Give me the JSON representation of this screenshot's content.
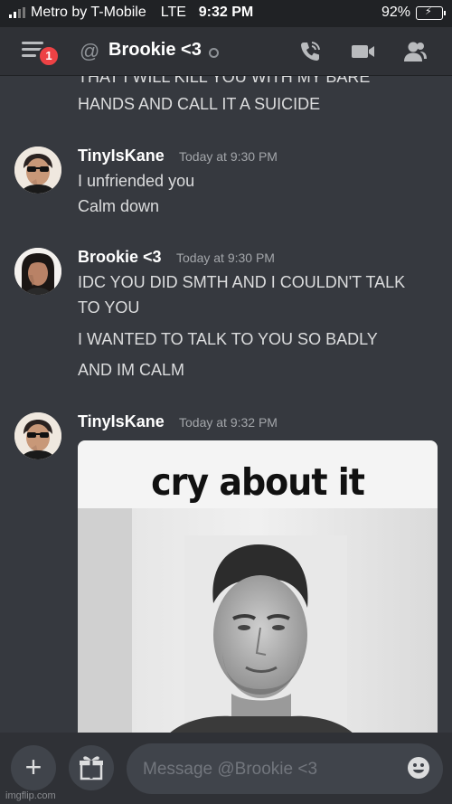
{
  "status_bar": {
    "carrier": "Metro by T-Mobile",
    "network": "LTE",
    "time": "9:32 PM",
    "battery": "92%",
    "battery_level": 0.92
  },
  "header": {
    "channel_name": "Brookie <3",
    "notification_count": "1"
  },
  "messages": {
    "partial_top": {
      "line1": "THAT I WILL KILL YOU WITH MY BARE",
      "line2": "HANDS AND CALL IT A SUICIDE"
    },
    "group1": {
      "author": "TinyIsKane",
      "timestamp": "Today at 9:30 PM",
      "lines": [
        "I unfriended you",
        "Calm down"
      ]
    },
    "group2": {
      "author": "Brookie <3",
      "timestamp": "Today at 9:30 PM",
      "lines": [
        "IDC YOU DID SMTH AND I COULDN'T TALK",
        "TO YOU",
        "I WANTED TO TALK TO YOU SO BADLY",
        "AND IM CALM"
      ]
    },
    "group3": {
      "author": "TinyIsKane",
      "timestamp": "Today at 9:32 PM",
      "image_caption": "cry about it"
    }
  },
  "composer": {
    "placeholder": "Message @Brookie <3"
  },
  "watermark": "imgflip.com",
  "colors": {
    "background": "#36393f",
    "header": "#2f3136",
    "badge": "#ed4245",
    "input": "#40444b"
  }
}
